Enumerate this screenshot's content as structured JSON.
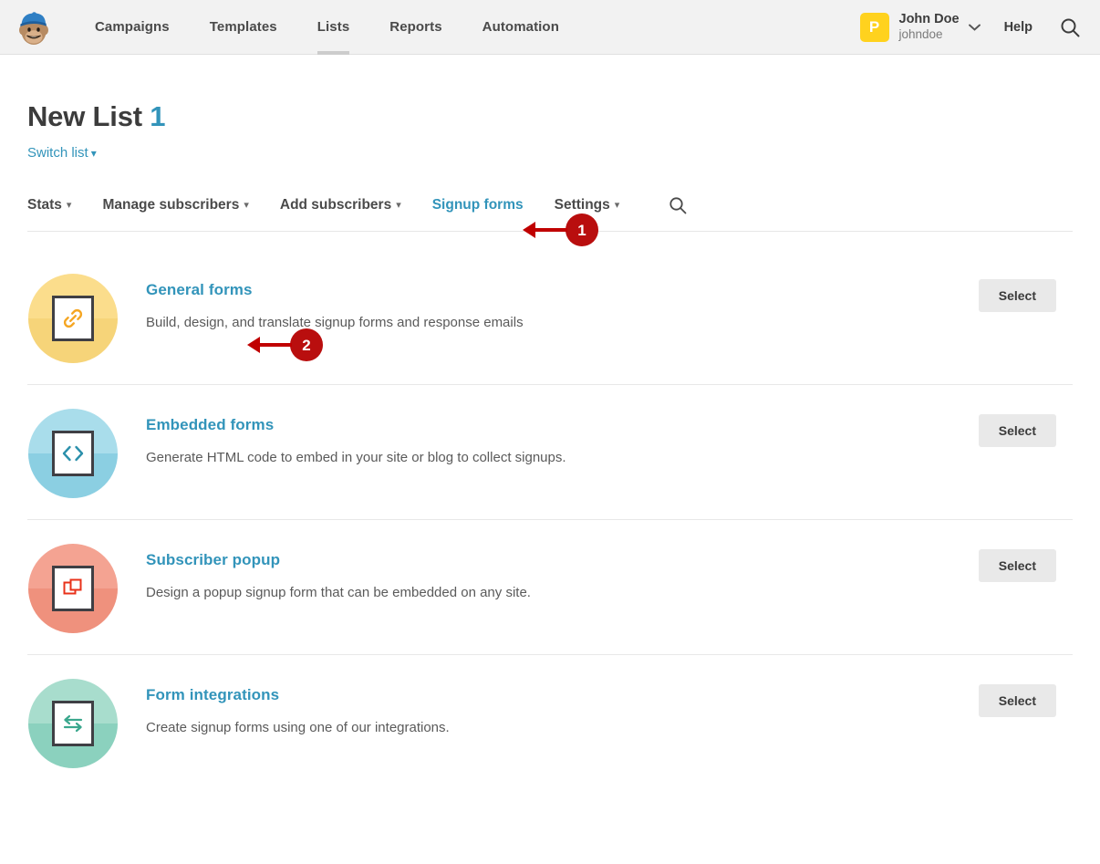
{
  "header": {
    "logo_name": "mailchimp-freddie-logo",
    "nav": [
      {
        "label": "Campaigns",
        "active": false
      },
      {
        "label": "Templates",
        "active": false
      },
      {
        "label": "Lists",
        "active": true
      },
      {
        "label": "Reports",
        "active": false
      },
      {
        "label": "Automation",
        "active": false
      }
    ],
    "account": {
      "avatar_letter": "P",
      "avatar_color": "#ffd21e",
      "name": "John Doe",
      "handle": "johndoe",
      "caret": "⌄"
    },
    "help_label": "Help",
    "search_icon": "search-icon"
  },
  "page": {
    "title": "New List",
    "list_number": "1",
    "switch_list_label": "Switch list",
    "chevron": "⌄"
  },
  "tabs": [
    {
      "label": "Stats",
      "has_chevron": true,
      "selected": false
    },
    {
      "label": "Manage subscribers",
      "has_chevron": true,
      "selected": false
    },
    {
      "label": "Add subscribers",
      "has_chevron": true,
      "selected": false
    },
    {
      "label": "Signup forms",
      "has_chevron": false,
      "selected": true
    },
    {
      "label": "Settings",
      "has_chevron": true,
      "selected": false
    }
  ],
  "tabs_search_icon": "search-icon",
  "rows": [
    {
      "title": "General forms",
      "desc": "Build, design, and translate signup forms and response emails",
      "button": "Select",
      "icon_name": "link-chain-icon",
      "circle_color": "#fbdd8c",
      "glyph_color": "#f5a623"
    },
    {
      "title": "Embedded forms",
      "desc": "Generate HTML code to embed in your site or blog to collect signups.",
      "button": "Select",
      "icon_name": "code-brackets-icon",
      "circle_color": "#a9ddeb",
      "glyph_color": "#2b90ab"
    },
    {
      "title": "Subscriber popup",
      "desc": "Design a popup signup form that can be embedded on any site.",
      "button": "Select",
      "icon_name": "overlapping-squares-icon",
      "circle_color": "#f4a392",
      "glyph_color": "#e8321a"
    },
    {
      "title": "Form integrations",
      "desc": "Create signup forms using one of our integrations.",
      "button": "Select",
      "icon_name": "exchange-arrows-icon",
      "circle_color": "#a8ddcd",
      "glyph_color": "#3aa78d"
    }
  ],
  "annotations": [
    {
      "number": "1",
      "target": "Signup forms tab"
    },
    {
      "number": "2",
      "target": "General forms link"
    }
  ],
  "colors": {
    "accent_link": "#3294ba",
    "annotation_red": "#b90e0e",
    "header_bg": "#f2f2f2",
    "brand_yellow": "#ffd21e"
  }
}
